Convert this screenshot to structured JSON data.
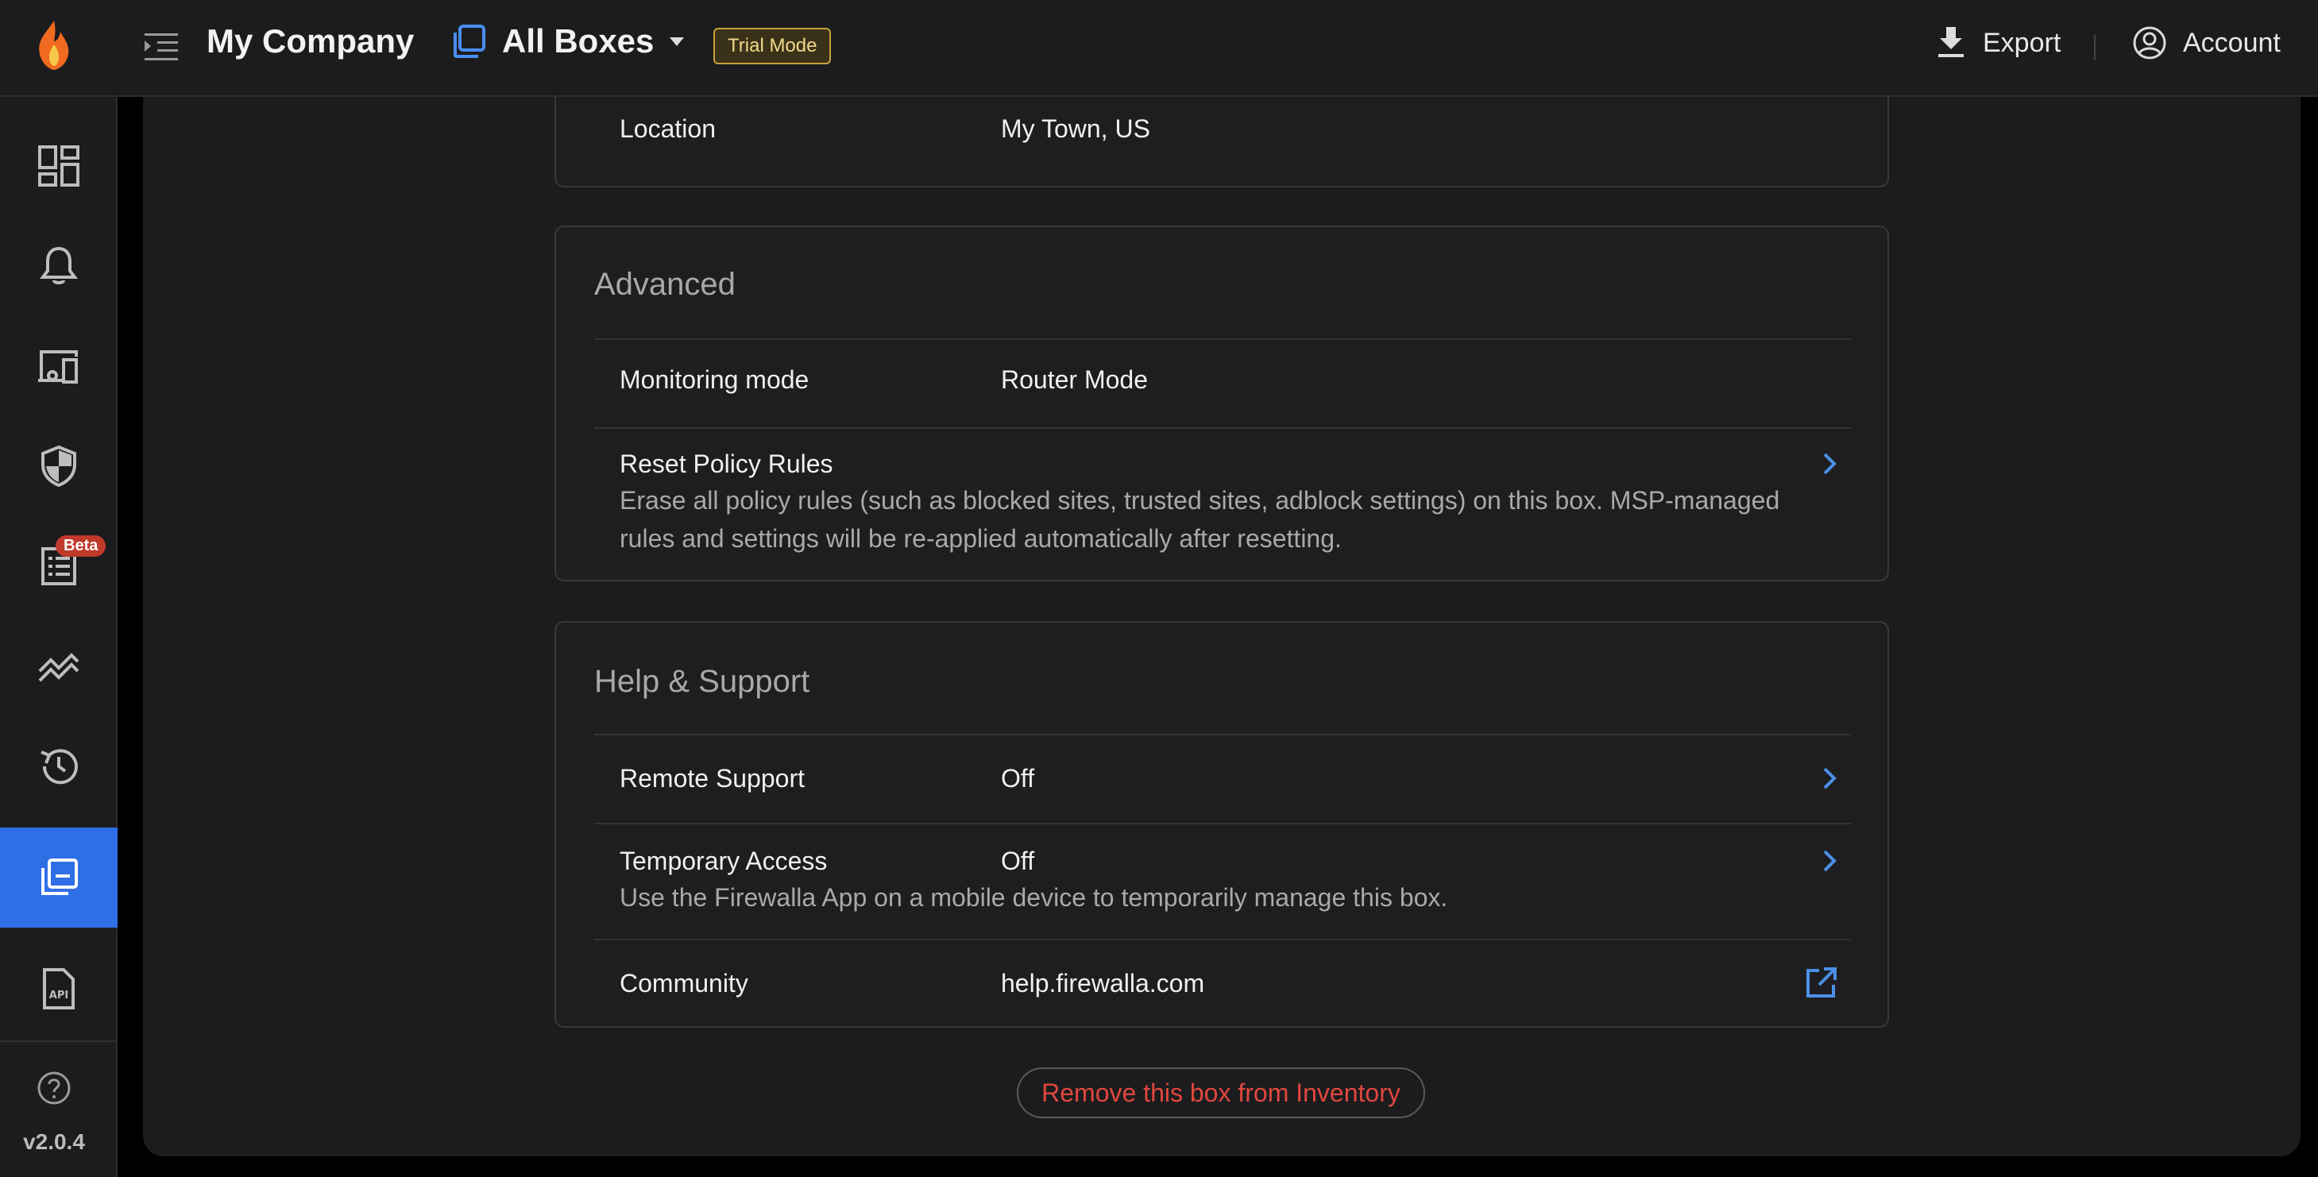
{
  "header": {
    "company": "My Company",
    "boxes_label": "All Boxes",
    "trial_badge": "Trial Mode",
    "export_label": "Export",
    "account_label": "Account"
  },
  "sidebar": {
    "items": [
      {
        "name": "dashboard",
        "icon": "dashboard-icon"
      },
      {
        "name": "alarms",
        "icon": "bell-icon"
      },
      {
        "name": "devices",
        "icon": "devices-icon"
      },
      {
        "name": "rules",
        "icon": "shield-icon"
      },
      {
        "name": "audit",
        "icon": "list-icon",
        "badge": "Beta"
      },
      {
        "name": "flows",
        "icon": "trends-icon"
      },
      {
        "name": "history",
        "icon": "history-icon"
      },
      {
        "name": "boxes",
        "icon": "boxes-icon",
        "active": true
      },
      {
        "name": "api",
        "icon": "api-doc-icon"
      }
    ],
    "help_icon": "help-circle-icon",
    "version": "v2.0.4"
  },
  "location_card": {
    "label": "Location",
    "value": "My Town, US"
  },
  "advanced": {
    "title": "Advanced",
    "monitoring_label": "Monitoring mode",
    "monitoring_value": "Router Mode",
    "reset_label": "Reset Policy Rules",
    "reset_desc": "Erase all policy rules (such as blocked sites, trusted sites, adblock settings) on this box. MSP-managed rules and settings will be re-applied automatically after resetting."
  },
  "support": {
    "title": "Help & Support",
    "remote_label": "Remote Support",
    "remote_value": "Off",
    "temp_label": "Temporary Access",
    "temp_value": "Off",
    "temp_desc": "Use the Firewalla App on a mobile device to temporarily manage this box.",
    "community_label": "Community",
    "community_value": "help.firewalla.com"
  },
  "remove_button": "Remove this box from Inventory",
  "colors": {
    "accent": "#2f6fe6",
    "danger": "#e0473e",
    "link": "#4a90e8",
    "trial_border": "#c9a23a"
  }
}
